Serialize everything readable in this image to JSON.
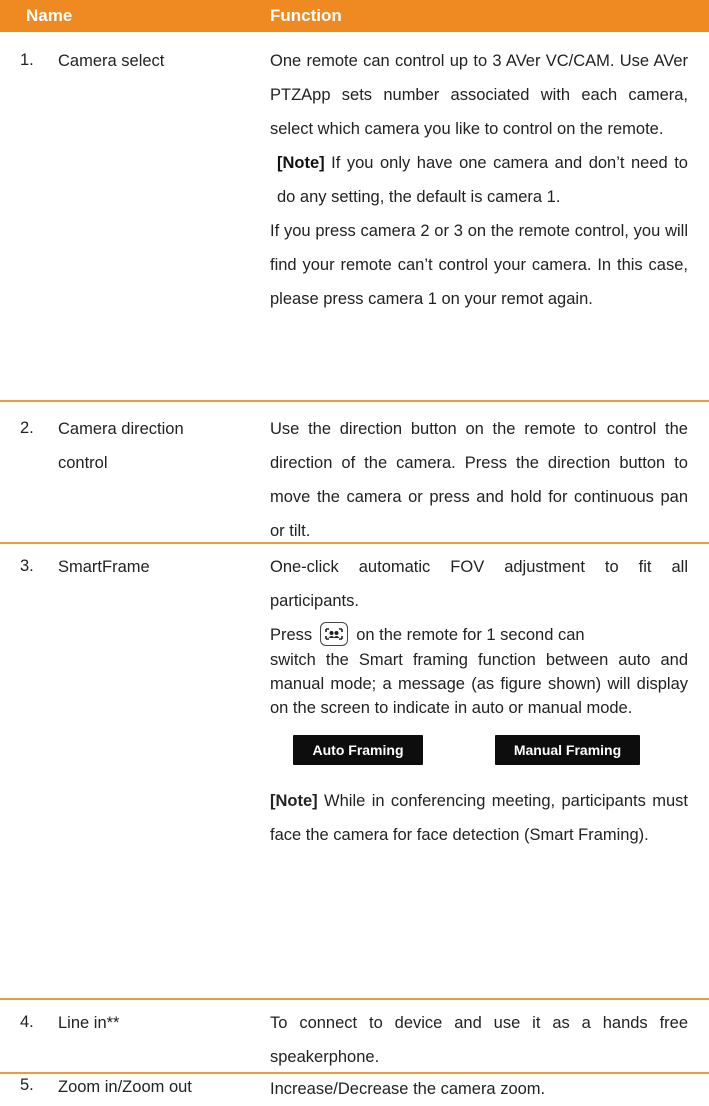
{
  "header": {
    "name": "Name",
    "function": "Function"
  },
  "rows": [
    {
      "number": "1.",
      "name": "Camera select",
      "paragraphs": [
        "One remote can control up to 3 AVer VC/CAM. Use AVer PTZApp sets number associated with each camera, select which camera you like to control on the remote.",
        "If you press camera 2 or 3 on the remote control, you will find your remote can’t control your camera. In this case, please press camera 1 on your remot again."
      ],
      "note_label": "[Note]",
      "note_text": " If you only have one camera and don’t need to do any setting, the default is camera 1."
    },
    {
      "number": "2.",
      "name_line1": "Camera direction",
      "name_line2": "control",
      "text": "Use the direction button on the remote to control the direction of the camera. Press the direction button to move the camera or press and hold for continuous pan or tilt."
    },
    {
      "number": "3.",
      "name": "SmartFrame",
      "text1": "One-click automatic FOV adjustment to fit all participants.",
      "press_before": "Press",
      "press_after": "on the remote for 1 second can",
      "text2": "switch the Smart framing function between auto and manual mode; a message (as figure shown) will display on the screen to indicate in auto or manual mode.",
      "badge_auto": "Auto Framing",
      "badge_manual": "Manual Framing",
      "note_label": "[Note]",
      "note_text": " While in conferencing meeting, participants must face the camera for face detection (Smart Framing).",
      "icon": "smart-framing-icon"
    },
    {
      "number": "4.",
      "name": "Line in**",
      "text": "To connect to device and use it as a hands free speakerphone."
    },
    {
      "number": "5.",
      "name": "Zoom in/Zoom out",
      "text": "Increase/Decrease the camera zoom."
    }
  ],
  "colors": {
    "header_bg": "#ef8a22",
    "rule": "#ef9a3a",
    "badge_bg": "#0d0d0d"
  }
}
